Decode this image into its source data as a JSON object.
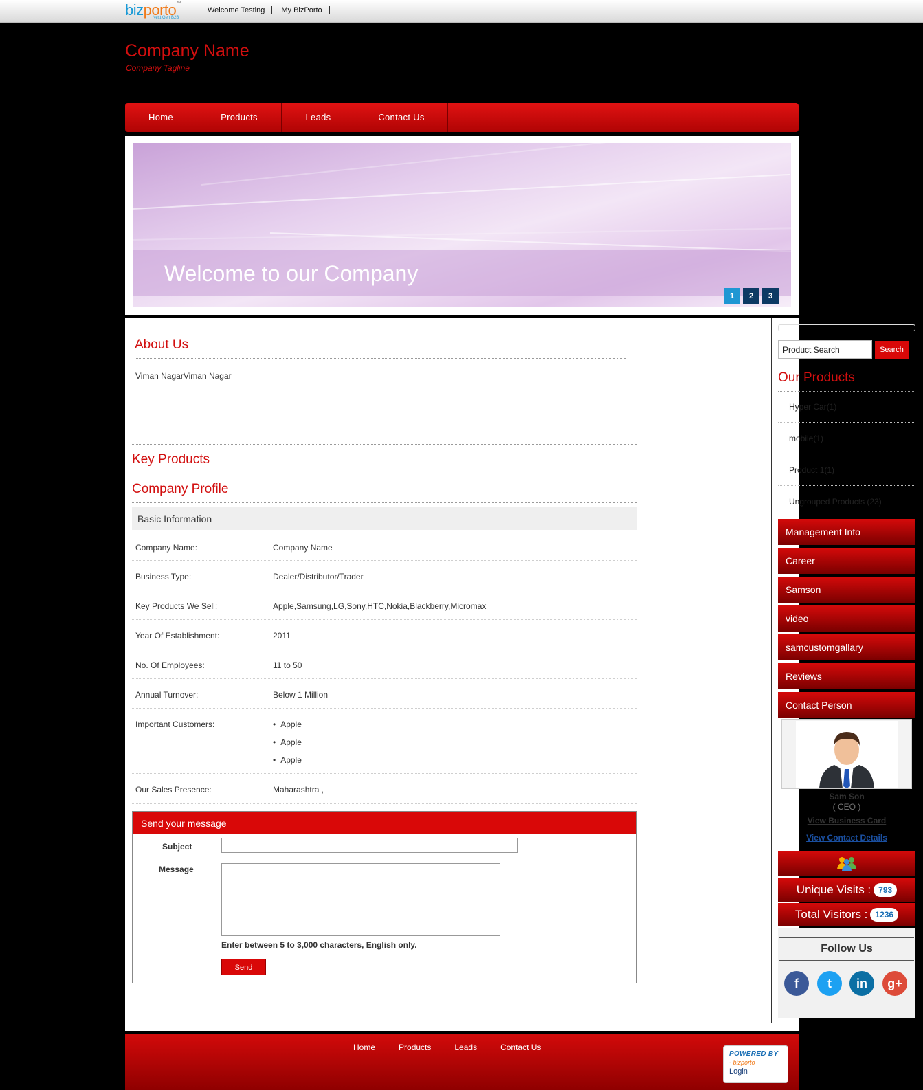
{
  "topbar": {
    "logo_biz": "biz",
    "logo_porto": "porto",
    "logo_tm": "™",
    "logo_sub": "Next Gen B2B",
    "links": [
      "Welcome Testing",
      "My BizPorto"
    ]
  },
  "header": {
    "company_name": "Company Name",
    "tagline": "Company Tagline"
  },
  "nav": [
    "Home",
    "Products",
    "Leads",
    "Contact Us"
  ],
  "banner": {
    "title": "Welcome to our Company",
    "pages": [
      "1",
      "2",
      "3"
    ],
    "active_page": "1"
  },
  "about": {
    "title": "About Us",
    "text": "Viman NagarViman Nagar"
  },
  "key_products": {
    "title": "Key Products"
  },
  "profile": {
    "title": "Company Profile",
    "subtitle": "Basic Information",
    "rows": [
      {
        "label": "Company Name:",
        "value": "Company Name"
      },
      {
        "label": "Business Type:",
        "value": "Dealer/Distributor/Trader"
      },
      {
        "label": "Key Products We Sell:",
        "value": "Apple,Samsung,LG,Sony,HTC,Nokia,Blackberry,Micromax"
      },
      {
        "label": "Year Of Establishment:",
        "value": "2011"
      },
      {
        "label": "No. Of Employees:",
        "value": "11 to 50"
      },
      {
        "label": "Annual Turnover:",
        "value": "Below 1 Million"
      },
      {
        "label": "Important Customers:",
        "values": [
          "Apple",
          "Apple",
          "Apple"
        ]
      },
      {
        "label": "Our Sales Presence:",
        "value": "Maharashtra ,"
      }
    ]
  },
  "message_form": {
    "title": "Send your message",
    "subject_label": "Subject",
    "message_label": "Message",
    "subject_value": "",
    "message_value": "",
    "hint": "Enter between 5 to 3,000 characters, English only.",
    "send_label": "Send"
  },
  "sidebar": {
    "search_placeholder": "Product Search",
    "search_button": "Search",
    "products_title": "Our Products",
    "products": [
      "Hyper Car(1)",
      "mobile(1)",
      "Product 1(1)",
      "Ungrouped Products (23)"
    ],
    "menu": [
      "Management Info",
      "Career",
      "Samson",
      "video",
      "samcustomgallary",
      "Reviews",
      "Contact Person"
    ],
    "contact": {
      "name": "Sam Son",
      "role": "( CEO )",
      "view_card": "View Business Card",
      "view_details": "View Contact Details",
      "avatar_icon": "person-avatar-icon"
    },
    "stats": {
      "unique_label": "Unique Visits :",
      "unique_value": "793",
      "total_label": "Total Visitors :",
      "total_value": "1236"
    },
    "follow_title": "Follow Us",
    "social": [
      {
        "name": "facebook-icon",
        "glyph": "f",
        "color": "#3b5998"
      },
      {
        "name": "twitter-icon",
        "glyph": "t",
        "color": "#1da1f2"
      },
      {
        "name": "linkedin-icon",
        "glyph": "in",
        "color": "#0b6fa4"
      },
      {
        "name": "google-plus-icon",
        "glyph": "g+",
        "color": "#dd4b39"
      }
    ]
  },
  "footer": {
    "links": [
      "Home",
      "Products",
      "Leads",
      "Contact Us"
    ],
    "powered_by": "POWERED BY",
    "powered_brand": "- bizporto",
    "login": "Login"
  },
  "colors": {
    "brand_red": "#d20f0f",
    "pager_active": "#1f97d3",
    "pager_inactive": "#0d3a64",
    "link_blue": "#1a4fa0"
  }
}
